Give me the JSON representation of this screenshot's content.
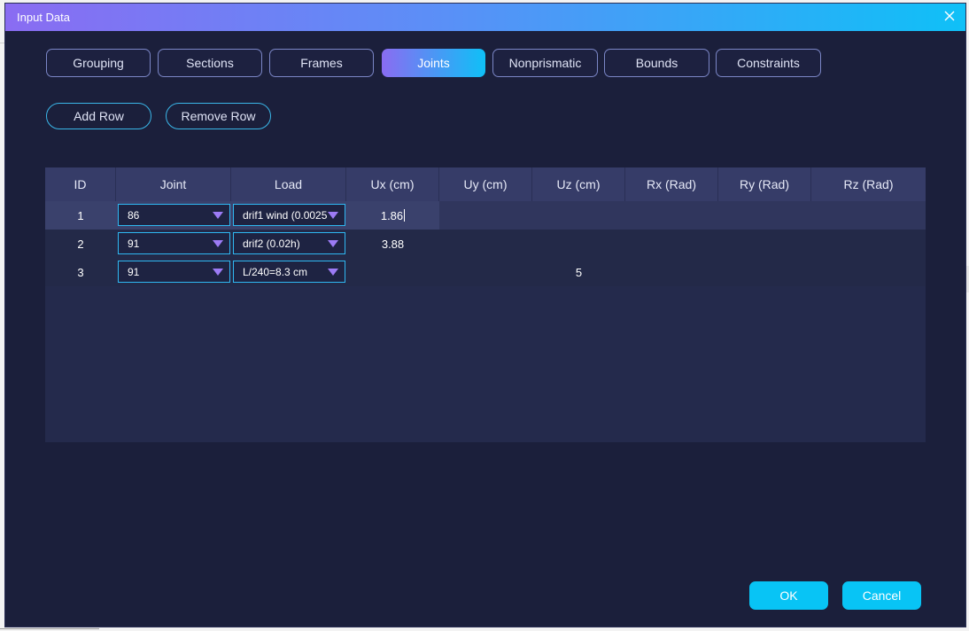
{
  "window": {
    "title": "Input Data"
  },
  "tabs": [
    {
      "label": "Grouping"
    },
    {
      "label": "Sections"
    },
    {
      "label": "Frames"
    },
    {
      "label": "Joints",
      "active": true
    },
    {
      "label": "Nonprismatic"
    },
    {
      "label": "Bounds"
    },
    {
      "label": "Constraints"
    }
  ],
  "toolbar": {
    "add_row_label": "Add Row",
    "remove_row_label": "Remove Row"
  },
  "table": {
    "headers": [
      "ID",
      "Joint",
      "Load",
      "Ux (cm)",
      "Uy (cm)",
      "Uz (cm)",
      "Rx (Rad)",
      "Ry (Rad)",
      "Rz (Rad)"
    ],
    "rows": [
      {
        "id": "1",
        "joint": "86",
        "load": "drif1 wind (0.0025",
        "ux": "1.86",
        "uy": "",
        "uz": "",
        "rx": "",
        "ry": "",
        "rz": ""
      },
      {
        "id": "2",
        "joint": "91",
        "load": "drif2 (0.02h)",
        "ux": "3.88",
        "uy": "",
        "uz": "",
        "rx": "",
        "ry": "",
        "rz": ""
      },
      {
        "id": "3",
        "joint": "91",
        "load": "L/240=8.3 cm",
        "ux": "",
        "uy": "",
        "uz": "5",
        "rx": "",
        "ry": "",
        "rz": ""
      }
    ]
  },
  "footer": {
    "ok_label": "OK",
    "cancel_label": "Cancel"
  },
  "colors": {
    "accent_start": "#8a6cf2",
    "accent_end": "#0fc0f7",
    "dialog_bg": "#1b1f3b",
    "button_cyan": "#08c4f5"
  }
}
